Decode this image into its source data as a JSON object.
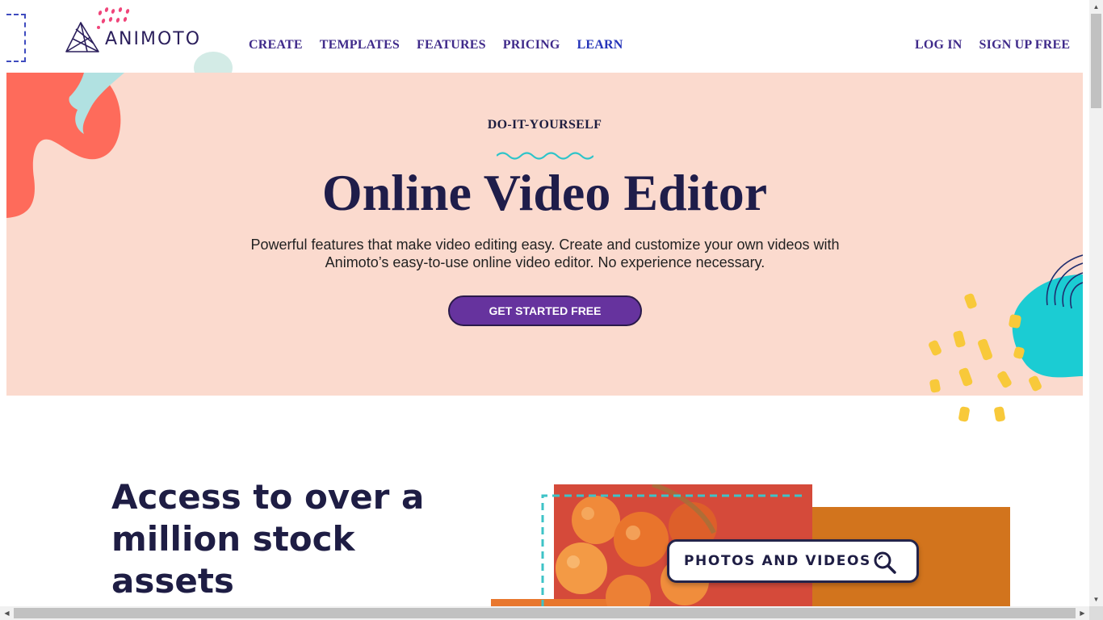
{
  "brand": {
    "name": "ANIMOTO"
  },
  "nav": {
    "left": [
      {
        "label": "CREATE"
      },
      {
        "label": "TEMPLATES"
      },
      {
        "label": "FEATURES"
      },
      {
        "label": "PRICING"
      },
      {
        "label": "LEARN"
      }
    ],
    "login": "LOG IN",
    "signup": "SIGN UP FREE"
  },
  "hero": {
    "eyebrow": "DO-IT-YOURSELF",
    "title": "Online Video Editor",
    "subtitle": "Powerful features that make video editing easy. Create and customize your own videos with Animoto’s easy-to-use online video editor. No experience necessary.",
    "cta": "GET STARTED FREE"
  },
  "stock": {
    "title": "Access to over a million stock assets",
    "search_label": "PHOTOS AND VIDEOS"
  },
  "icons": [
    "animoto-logo-icon",
    "search-icon",
    "chevron-up-icon",
    "chevron-down-icon",
    "chevron-left-icon",
    "chevron-right-icon"
  ],
  "colors": {
    "hero_bg": "#fbdace",
    "brand_purple": "#66339e",
    "nav_text": "#3f2a8a",
    "heading": "#1f1d4a",
    "coral": "#fe6b5b",
    "teal": "#1bccd3",
    "yellow": "#f8c93a"
  }
}
